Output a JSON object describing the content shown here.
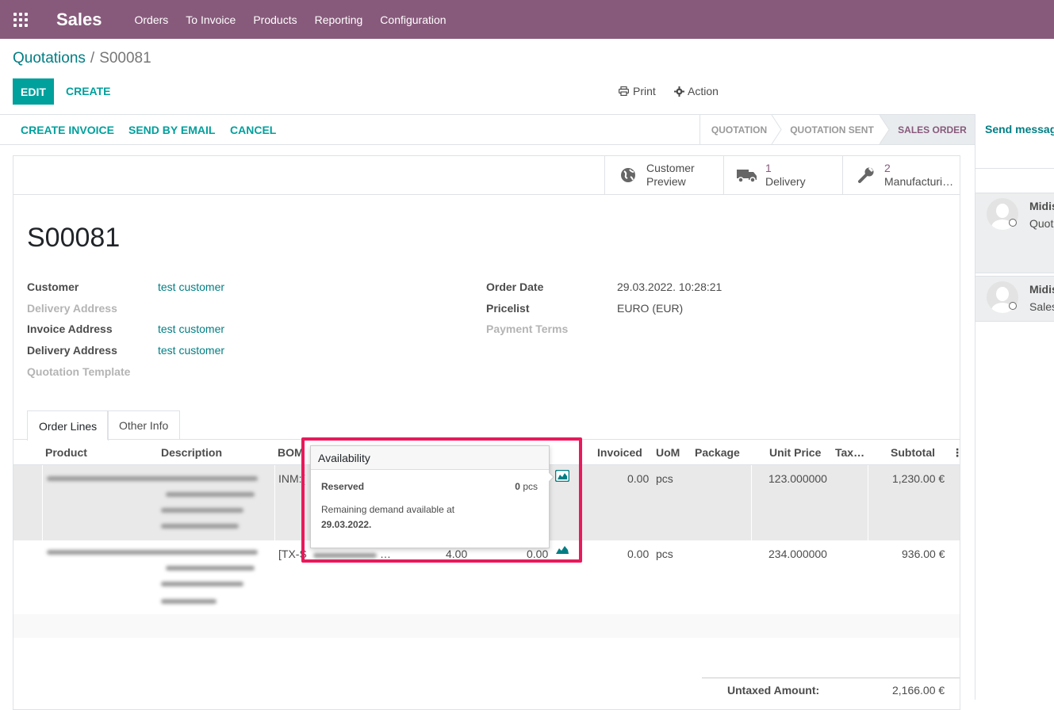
{
  "navbar": {
    "brand": "Sales",
    "menu": [
      "Orders",
      "To Invoice",
      "Products",
      "Reporting",
      "Configuration"
    ],
    "color": "#875a7b"
  },
  "breadcrumb": {
    "parent": "Quotations",
    "separator": "/",
    "current": "S00081"
  },
  "buttons": {
    "edit": "EDIT",
    "create": "CREATE",
    "print": "Print",
    "action": "Action"
  },
  "statusbar": {
    "actions": [
      "CREATE INVOICE",
      "SEND BY EMAIL",
      "CANCEL"
    ],
    "stages": [
      "QUOTATION",
      "QUOTATION SENT",
      "SALES ORDER"
    ],
    "active_stage": "SALES ORDER"
  },
  "chatter": {
    "send_message": "Send message",
    "messages": [
      {
        "author": "Midis",
        "body": "Quot"
      },
      {
        "author": "Midis",
        "body": "Sales"
      }
    ]
  },
  "smart_buttons": [
    {
      "icon": "globe-icon",
      "line1": "Customer",
      "line2": "Preview"
    },
    {
      "icon": "truck-icon",
      "count": "1",
      "label": "Delivery"
    },
    {
      "icon": "wrench-icon",
      "count": "2",
      "label": "Manufacturi…"
    }
  ],
  "order": {
    "name": "S00081",
    "fields_left": [
      {
        "label": "Customer",
        "value": "test customer",
        "muted": false
      },
      {
        "label": "Delivery Address",
        "value": "",
        "muted": true
      },
      {
        "label": "Invoice Address",
        "value": "test customer",
        "muted": false
      },
      {
        "label": "Delivery Address",
        "value": "test customer",
        "muted": false
      },
      {
        "label": "Quotation Template",
        "value": "",
        "muted": true
      }
    ],
    "fields_right": [
      {
        "label": "Order Date",
        "value": "29.03.2022. 10:28:21",
        "muted": false
      },
      {
        "label": "Pricelist",
        "value": "EURO (EUR)",
        "muted": false
      },
      {
        "label": "Payment Terms",
        "value": "",
        "muted": true
      }
    ]
  },
  "tabs": [
    "Order Lines",
    "Other Info"
  ],
  "table": {
    "columns": [
      "Product",
      "Description",
      "BOM",
      "Invoiced",
      "UoM",
      "Package",
      "Unit Price",
      "Tax…",
      "Subtotal"
    ],
    "rows": [
      {
        "bom": "INM:[",
        "qty": "",
        "delivered": "",
        "invoiced": "0.00",
        "uom": "pcs",
        "unit_price": "123.000000",
        "subtotal": "1,230.00 €"
      },
      {
        "bom": "[TX-S",
        "bom_tail": "…",
        "qty": "4.00",
        "delivered": "0.00",
        "invoiced": "0.00",
        "uom": "pcs",
        "unit_price": "234.000000",
        "subtotal": "936.00 €"
      }
    ]
  },
  "totals": {
    "untaxed_label": "Untaxed Amount:",
    "untaxed_value": "2,166.00 €"
  },
  "popover": {
    "title": "Availability",
    "reserved_label": "Reserved",
    "reserved_qty": "0",
    "reserved_unit": "pcs",
    "note_line1": "Remaining demand available at",
    "note_date": "29.03.2022."
  },
  "colors": {
    "accent": "#00a09d",
    "link": "#017e84",
    "highlight": "#e8195c"
  }
}
